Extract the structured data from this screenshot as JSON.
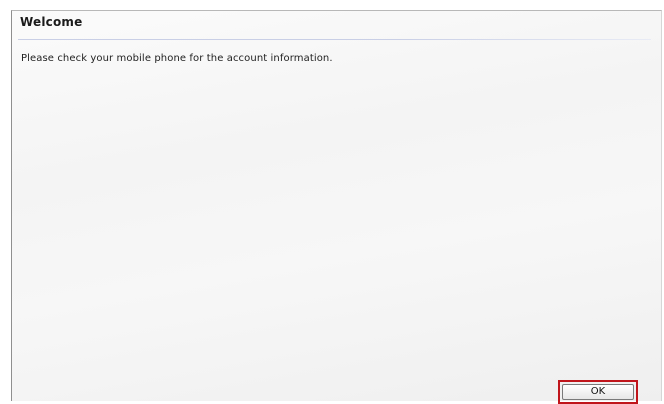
{
  "dialog": {
    "title": "Welcome",
    "message": "Please check your mobile phone for the account information.",
    "ok_label": "OK"
  },
  "colors": {
    "highlight_border": "#c0151b",
    "title_rule": "#c9cfe6"
  }
}
